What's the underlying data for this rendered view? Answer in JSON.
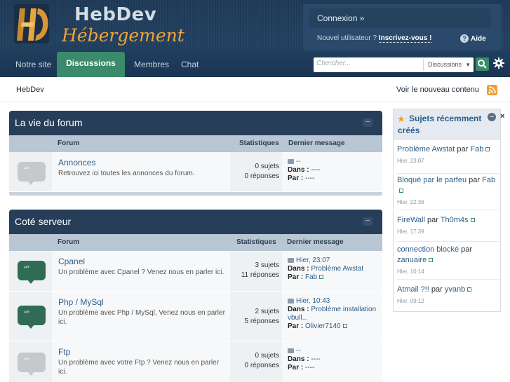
{
  "header": {
    "logo_line1": "HebDev",
    "logo_line2": "Hébergement",
    "login_label": "Connexion »",
    "new_user_text": "Nouvel utilisateur ?",
    "register_label": "Inscrivez-vous !",
    "help_label": "Aide"
  },
  "nav": {
    "items": [
      "Notre site",
      "Discussions",
      "Membres",
      "Chat"
    ],
    "search_placeholder": "Chercher...",
    "search_scope": "Discussions"
  },
  "breadcrumb": {
    "home": "HebDev",
    "new_content": "Voir le nouveau contenu"
  },
  "columns": {
    "forum": "Forum",
    "stats": "Statistiques",
    "last": "Dernier message"
  },
  "labels": {
    "in": "Dans :",
    "by": "Par :"
  },
  "categories": [
    {
      "title": "La vie du forum",
      "forums": [
        {
          "name": "Annonces",
          "desc": "Retrouvez ici toutes les annonces du forum.",
          "topics": "0 sujets",
          "replies": "0 réponses",
          "last_date": "--",
          "last_in": "----",
          "last_by": "----"
        }
      ]
    },
    {
      "title": "Coté serveur",
      "forums": [
        {
          "name": "Cpanel",
          "desc": "Un problème avec Cpanel ? Venez nous en parler ici.",
          "topics": "3 sujets",
          "replies": "11 réponses",
          "last_date": "Hier, 23:07",
          "last_in": "Problème Awstat",
          "last_by": "Fab"
        },
        {
          "name": "Php / MySql",
          "desc": "Un problème avec Php / MySql, Venez nous en parler ici.",
          "topics": "2 sujets",
          "replies": "5 réponses",
          "last_date": "Hier, 10:43",
          "last_in": "Problème installation vbull...",
          "last_by": "Olivier7140"
        },
        {
          "name": "Ftp",
          "desc": "Un problème avec votre Ftp ? Venez nous en parler ici.",
          "topics": "0 sujets",
          "replies": "0 réponses",
          "last_date": "--",
          "last_in": "----",
          "last_by": "----"
        }
      ]
    }
  ],
  "sidebar": {
    "title": "Sujets récemment créés",
    "by_word": "par",
    "items": [
      {
        "topic": "Problème Awstat",
        "author": "Fab",
        "date": "Hier, 23:07"
      },
      {
        "topic": "Bloqué par le parfeu",
        "author": "Fab",
        "date": "Hier, 22:36"
      },
      {
        "topic": "FireWall",
        "author": "Th0m4s",
        "date": "Hier, 17:39"
      },
      {
        "topic": "connection blocké",
        "author": "zanuaire",
        "date": "Hier, 10:14"
      },
      {
        "topic": "Atmail ?!!",
        "author": "yvanb",
        "date": "Hier, 09:12"
      }
    ]
  },
  "colors": {
    "header_bg": "#214161",
    "accent_green": "#3a8a6b",
    "logo_orange": "#f0a33a",
    "link_blue": "#2d5e8a"
  },
  "icons": [
    "gear-icon",
    "search-icon",
    "rss-icon",
    "help-icon",
    "forum-bubble-icon",
    "star-icon"
  ]
}
